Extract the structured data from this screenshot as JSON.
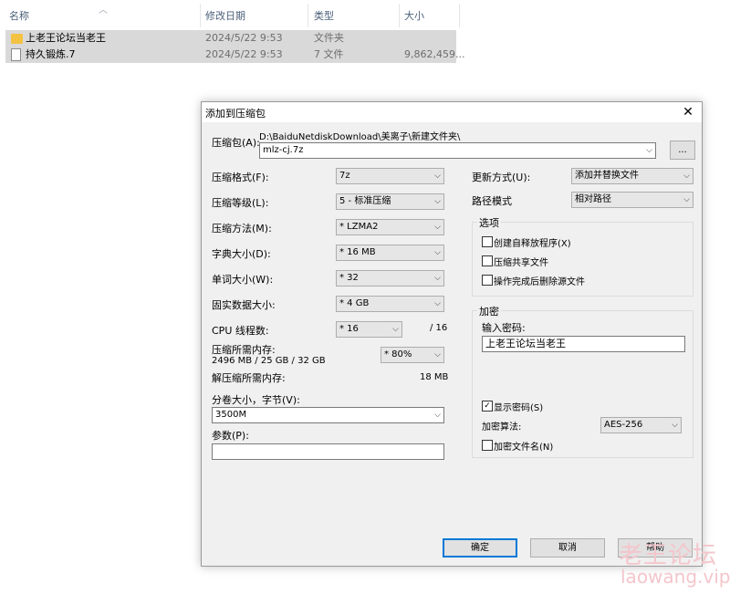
{
  "explorer": {
    "headers": {
      "name": "名称",
      "date": "修改日期",
      "type": "类型",
      "size": "大小"
    },
    "rows": [
      {
        "name": "上老王论坛当老王",
        "date": "2024/5/22 9:53",
        "type": "文件夹",
        "size": "",
        "icon": "folder-icon"
      },
      {
        "name": "持久锻炼.7",
        "date": "2024/5/22 9:53",
        "type": "7 文件",
        "size": "9,862,459...",
        "icon": "file-icon"
      }
    ]
  },
  "dialog": {
    "title": "添加到压缩包",
    "close_glyph": "✕",
    "archive_label": "压缩包(A):",
    "archive_path": "D:\\BaiduNetdiskDownload\\美离子\\新建文件夹\\",
    "archive_name": "mlz-cj.7z",
    "browse_label": "...",
    "format_label": "压缩格式(F):",
    "format_value": "7z",
    "level_label": "压缩等级(L):",
    "level_value": "5 - 标准压缩",
    "method_label": "压缩方法(M):",
    "method_value": "* LZMA2",
    "dict_label": "字典大小(D):",
    "dict_value": "* 16 MB",
    "word_label": "单词大小(W):",
    "word_value": "* 32",
    "solid_label": "固实数据大小:",
    "solid_value": "* 4 GB",
    "cpu_label": "CPU 线程数:",
    "cpu_value": "* 16",
    "cpu_total": "/ 16",
    "mem_comp_label": "压缩所需内存:",
    "mem_comp_value": "2496 MB / 25 GB / 32 GB",
    "mem_percent": "* 80%",
    "mem_decomp_label": "解压缩所需内存:",
    "mem_decomp_value": "18 MB",
    "split_label": "分卷大小，字节(V):",
    "split_value": "3500M",
    "params_label": "参数(P):",
    "params_value": "",
    "update_label": "更新方式(U):",
    "update_value": "添加并替换文件",
    "path_label": "路径模式",
    "path_value": "相对路径",
    "options_title": "选项",
    "opt_sfx": "创建自释放程序(X)",
    "opt_shared": "压缩共享文件",
    "opt_delete": "操作完成后删除源文件",
    "enc_title": "加密",
    "pwd_label": "输入密码:",
    "pwd_value": "上老王论坛当老王",
    "show_pwd": "显示密码(S)",
    "enc_method_label": "加密算法:",
    "enc_method_value": "AES-256",
    "enc_names": "加密文件名(N)",
    "ok": "确定",
    "cancel": "取消",
    "help": "帮助",
    "check_glyph": "✓",
    "dropdown_glyph": "⌵"
  },
  "watermark": {
    "line1": "老王论坛",
    "line2": "laowang.vip"
  }
}
